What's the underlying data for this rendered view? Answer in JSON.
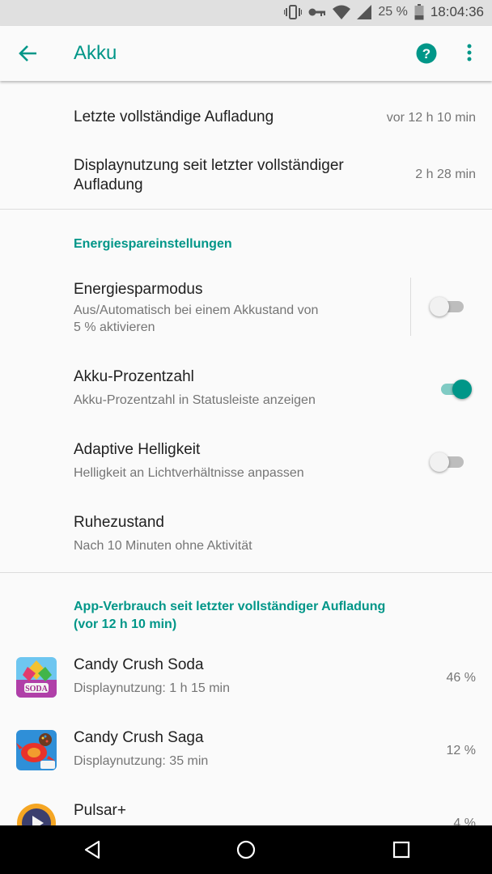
{
  "status_bar": {
    "battery_percent": "25 %",
    "time": "18:04:36",
    "icons": [
      "vibrate-icon",
      "key-icon",
      "wifi-icon",
      "signal-icon",
      "battery-icon"
    ]
  },
  "app_bar": {
    "title": "Akku",
    "icons": [
      "back-arrow-icon",
      "help-icon",
      "more-vert-icon"
    ]
  },
  "summary": [
    {
      "label": "Letzte vollständige Aufladung",
      "value": "vor 12 h 10 min"
    },
    {
      "label_line1": "Displaynutzung seit letzter vollständiger",
      "label_line2": "Aufladung",
      "value": "2 h 28 min"
    }
  ],
  "power_section": {
    "header": "Energiespareinstellungen",
    "items": [
      {
        "title": "Energiesparmodus",
        "subtitle_line1": "Aus/Automatisch bei einem Akkustand von",
        "subtitle_line2": "5 % aktivieren",
        "toggle": false
      },
      {
        "title": "Akku-Prozentzahl",
        "subtitle": "Akku-Prozentzahl in Statusleiste anzeigen",
        "toggle": true
      },
      {
        "title": "Adaptive Helligkeit",
        "subtitle": "Helligkeit an Lichtverhältnisse anpassen",
        "toggle": false
      },
      {
        "title": "Ruhezustand",
        "subtitle": "Nach 10 Minuten ohne Aktivität"
      }
    ]
  },
  "usage_section": {
    "header_line1": "App-Verbrauch seit letzter vollständiger Aufladung",
    "header_line2": "(vor 12 h 10 min)",
    "apps": [
      {
        "name": "Candy Crush Soda",
        "detail": "Displaynutzung: 1 h 15 min",
        "percent": "46 %",
        "icon": "candy-crush-soda-icon"
      },
      {
        "name": "Candy Crush Saga",
        "detail": "Displaynutzung: 35 min",
        "percent": "12 %",
        "icon": "candy-crush-saga-icon"
      },
      {
        "name": "Pulsar+",
        "percent": "4 %",
        "icon": "pulsar-icon"
      }
    ]
  },
  "nav_bar": {
    "icons": [
      "back-triangle-icon",
      "home-circle-icon",
      "recents-square-icon"
    ]
  },
  "colors": {
    "accent": "#009688",
    "accent_light": "#80cbc4",
    "status_bar_bg": "#e0e0e0",
    "background": "#fafafa",
    "secondary_text": "#757575"
  }
}
